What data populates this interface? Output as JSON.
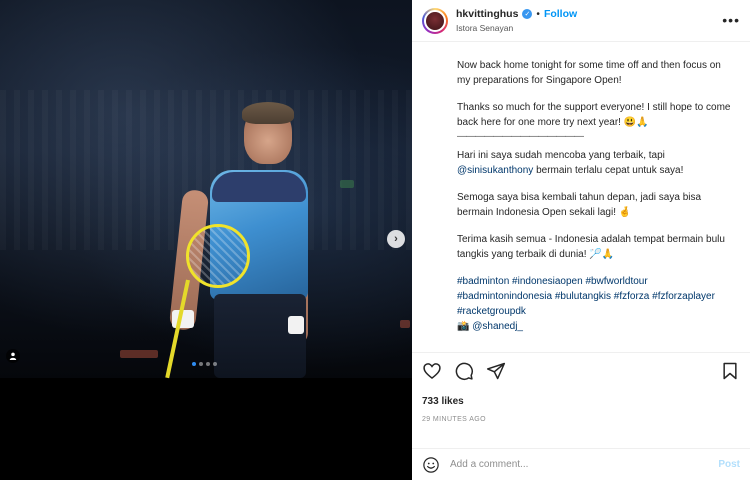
{
  "media": {
    "dot_count": 4,
    "active_dot": 0,
    "next_glyph": "›"
  },
  "header": {
    "username": "hkvittinghus",
    "separator": "•",
    "follow_label": "Follow",
    "location": "Istora Senayan",
    "more_glyph": "•••"
  },
  "caption": {
    "para1": "Now back home tonight for some time off and then focus on my preparations for Singapore Open!",
    "para2": "Thanks so much for the support everyone! I still hope to come back here for one more try next year! 😃🙏",
    "rule": "——————————————",
    "para3_pre": "Hari ini saya sudah mencoba yang terbaik, tapi ",
    "para3_mention": "@sinisukanthony",
    "para3_post": " bermain terlalu cepat untuk saya!",
    "para4": "Semoga saya bisa kembali tahun depan, jadi saya bisa bermain Indonesia Open sekali lagi! 🤞",
    "para5": "Terima kasih semua - Indonesia adalah tempat bermain bulu tangkis yang terbaik di dunia! 🏸🙏",
    "tags_line1": "#badminton #indonesiaopen #bwfworldtour",
    "tags_line2": "#badmintonindonesia #bulutangkis #fzforza #fzforzaplayer",
    "tags_line3": "#racketgroupdk",
    "credit_icon": "📸",
    "credit": "@shanedj_"
  },
  "engagement": {
    "likes": "733 likes",
    "time": "29 MINUTES AGO"
  },
  "comment": {
    "placeholder": "Add a comment...",
    "post_label": "Post"
  },
  "colors": {
    "link": "#00376b",
    "follow": "#0095f6",
    "post_disabled": "#b2dffc",
    "active_dot": "#2f8cf0"
  }
}
